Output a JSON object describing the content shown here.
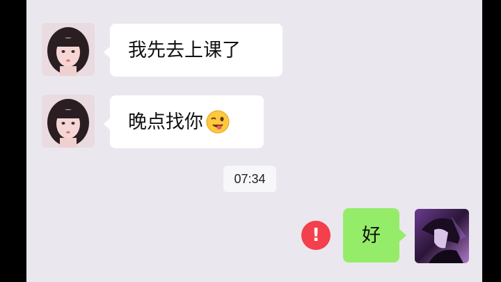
{
  "messages": [
    {
      "side": "left",
      "text": "我先去上课了",
      "avatar": "girl-avatar"
    },
    {
      "side": "left",
      "text": "晚点找你",
      "emoji": "winking-face-tongue-emoji",
      "avatar": "girl-avatar"
    },
    {
      "side": "right",
      "text": "好",
      "status": "send-failed",
      "avatar": "anime-avatar"
    }
  ],
  "timestamp": "07:34",
  "colors": {
    "chat_background": "#eae7ef",
    "incoming_bubble": "#ffffff",
    "outgoing_bubble": "#95ec69",
    "error_badge": "#f3404c"
  }
}
